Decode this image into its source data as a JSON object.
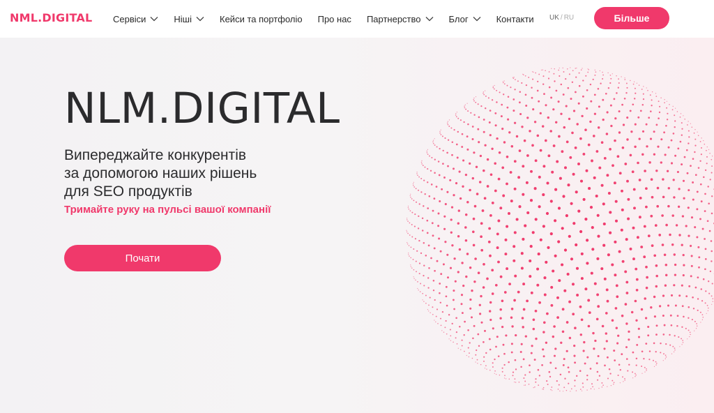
{
  "brand": {
    "logo_text": "NML.DIGITAL",
    "accent_color": "#f0396b"
  },
  "nav": {
    "items": [
      {
        "label": "Сервіси",
        "has_dropdown": true
      },
      {
        "label": "Ніші",
        "has_dropdown": true
      },
      {
        "label": "Кейси та портфоліо",
        "has_dropdown": false
      },
      {
        "label": "Про нас",
        "has_dropdown": false
      },
      {
        "label": "Партнерство",
        "has_dropdown": true
      },
      {
        "label": "Блог",
        "has_dropdown": true
      },
      {
        "label": "Контакти",
        "has_dropdown": false
      }
    ],
    "dropdown_icon": "chevron-down-icon"
  },
  "language": {
    "active": "UK",
    "separator": "/",
    "inactive": "RU"
  },
  "header_button": {
    "label": "Більше"
  },
  "hero": {
    "title": "NLM.DIGITAL",
    "subtitle_lines": [
      "Випереджайте конкурентів",
      "за допомогою наших рішень",
      "для SEO продуктів"
    ],
    "tagline": "Тримайте руку на пульсі вашої компанії",
    "cta_label": "Почати",
    "decoration": "dotted-sphere",
    "colors": {
      "title": "#2b2b2d",
      "dots": "#f0396b",
      "background": "#f4f3f5"
    }
  }
}
